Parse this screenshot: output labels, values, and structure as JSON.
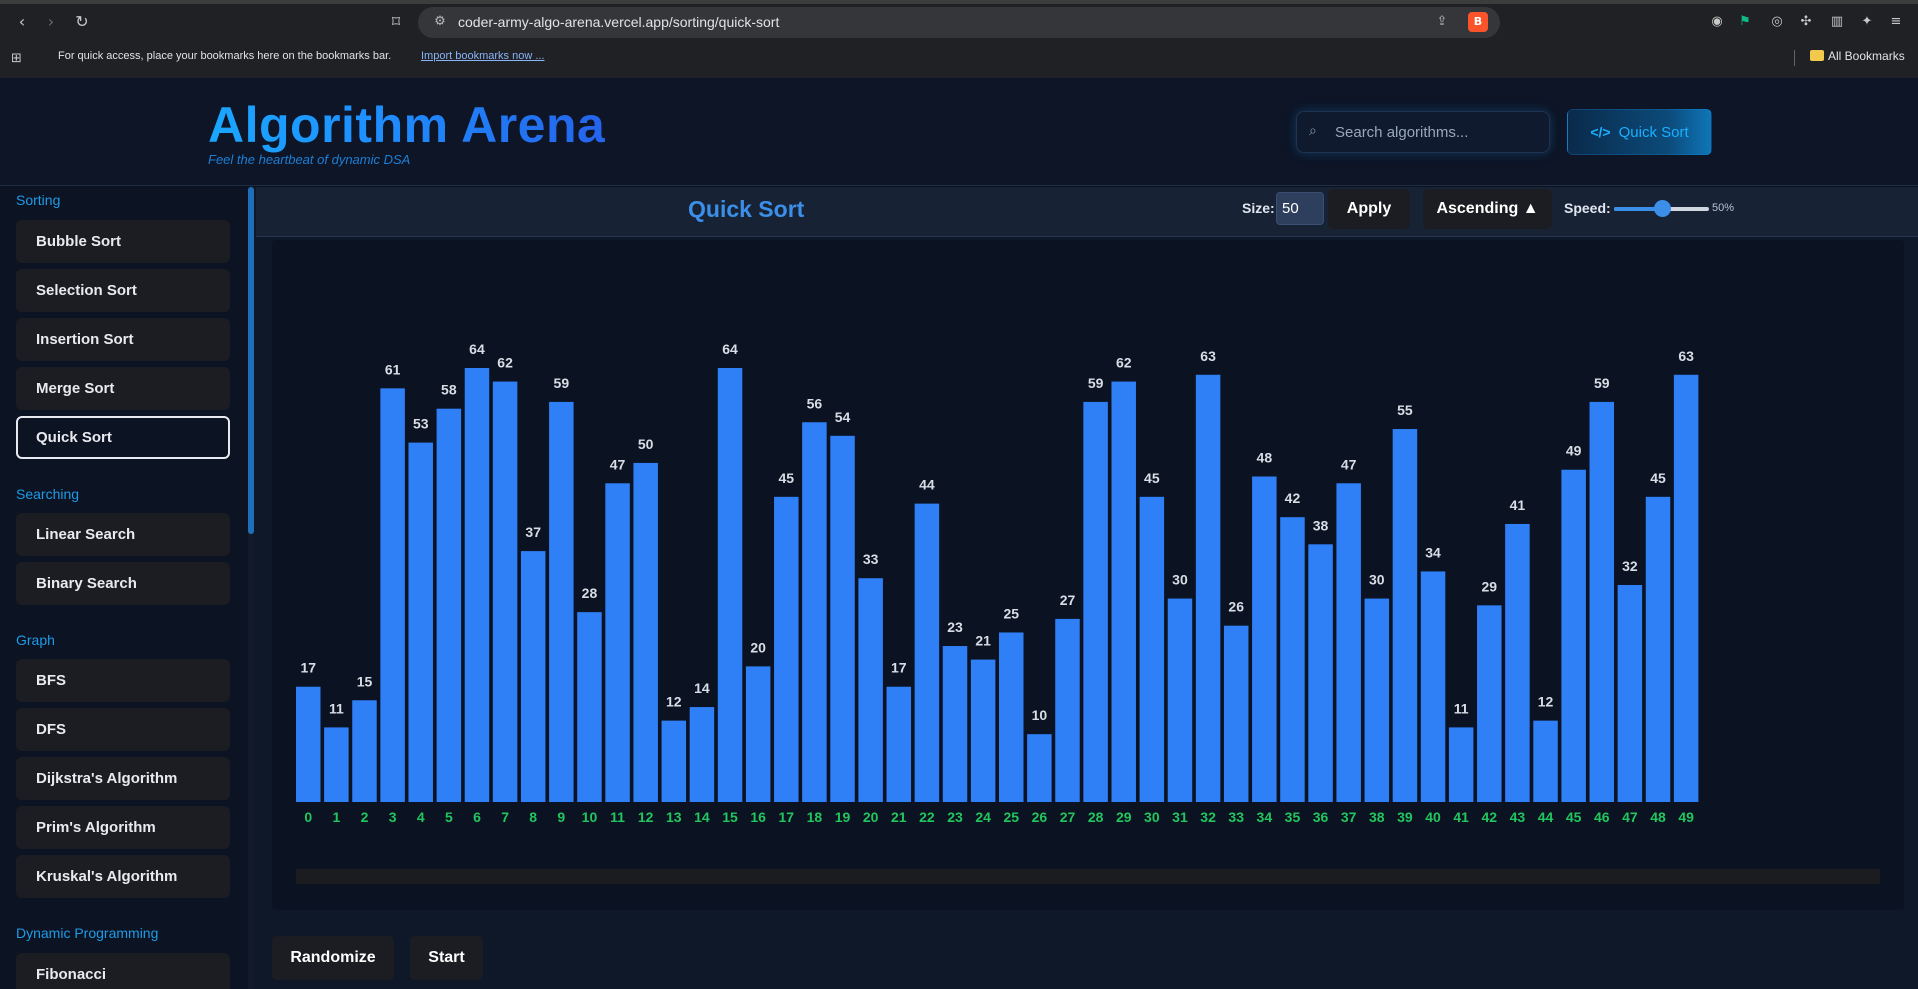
{
  "browser": {
    "url": "coder-army-algo-arena.vercel.app/sorting/quick-sort",
    "bookmarks_hint": "For quick access, place your bookmarks here on the bookmarks bar.",
    "import_link": "Import bookmarks now ...",
    "all_bookmarks": "All Bookmarks"
  },
  "header": {
    "title": "Algorithm Arena",
    "subtitle": "Feel the heartbeat of dynamic DSA",
    "search_placeholder": "Search algorithms...",
    "current_algorithm": "Quick Sort"
  },
  "sidebar": {
    "sections": [
      {
        "label": "Sorting",
        "items": [
          "Bubble Sort",
          "Selection Sort",
          "Insertion Sort",
          "Merge Sort",
          "Quick Sort"
        ]
      },
      {
        "label": "Searching",
        "items": [
          "Linear Search",
          "Binary Search"
        ]
      },
      {
        "label": "Graph",
        "items": [
          "BFS",
          "DFS",
          "Dijkstra's Algorithm",
          "Prim's Algorithm",
          "Kruskal's Algorithm"
        ]
      },
      {
        "label": "Dynamic Programming",
        "items": [
          "Fibonacci"
        ]
      }
    ],
    "active_item": "Quick Sort"
  },
  "toolbar": {
    "title": "Quick Sort",
    "size_label": "Size:",
    "size_value": "50",
    "apply_label": "Apply",
    "order_label": "Ascending ▲",
    "speed_label": "Speed:",
    "speed_value": 0.5,
    "speed_text": "50%"
  },
  "actions": {
    "randomize_label": "Randomize",
    "start_label": "Start"
  },
  "colors": {
    "bar": "#2f7ff7",
    "bar_label": "#d8dde6",
    "index_label": "#22c55e",
    "accent": "#1aa7ff"
  },
  "chart_data": {
    "type": "bar",
    "categories": [
      "0",
      "1",
      "2",
      "3",
      "4",
      "5",
      "6",
      "7",
      "8",
      "9",
      "10",
      "11",
      "12",
      "13",
      "14",
      "15",
      "16",
      "17",
      "18",
      "19",
      "20",
      "21",
      "22",
      "23",
      "24",
      "25",
      "26",
      "27",
      "28",
      "29",
      "30",
      "31",
      "32",
      "33",
      "34",
      "35",
      "36",
      "37",
      "38",
      "39",
      "40",
      "41",
      "42",
      "43",
      "44",
      "45",
      "46",
      "47",
      "48",
      "49"
    ],
    "values": [
      17,
      11,
      15,
      61,
      53,
      58,
      64,
      62,
      37,
      59,
      28,
      47,
      50,
      12,
      14,
      64,
      20,
      45,
      56,
      54,
      33,
      17,
      44,
      23,
      21,
      25,
      10,
      27,
      59,
      62,
      45,
      30,
      63,
      26,
      48,
      42,
      38,
      47,
      30,
      55,
      34,
      11,
      29,
      41,
      12,
      49,
      59,
      32,
      45,
      63
    ],
    "title": "",
    "xlabel": "",
    "ylabel": "",
    "ylim": [
      0,
      64
    ]
  }
}
